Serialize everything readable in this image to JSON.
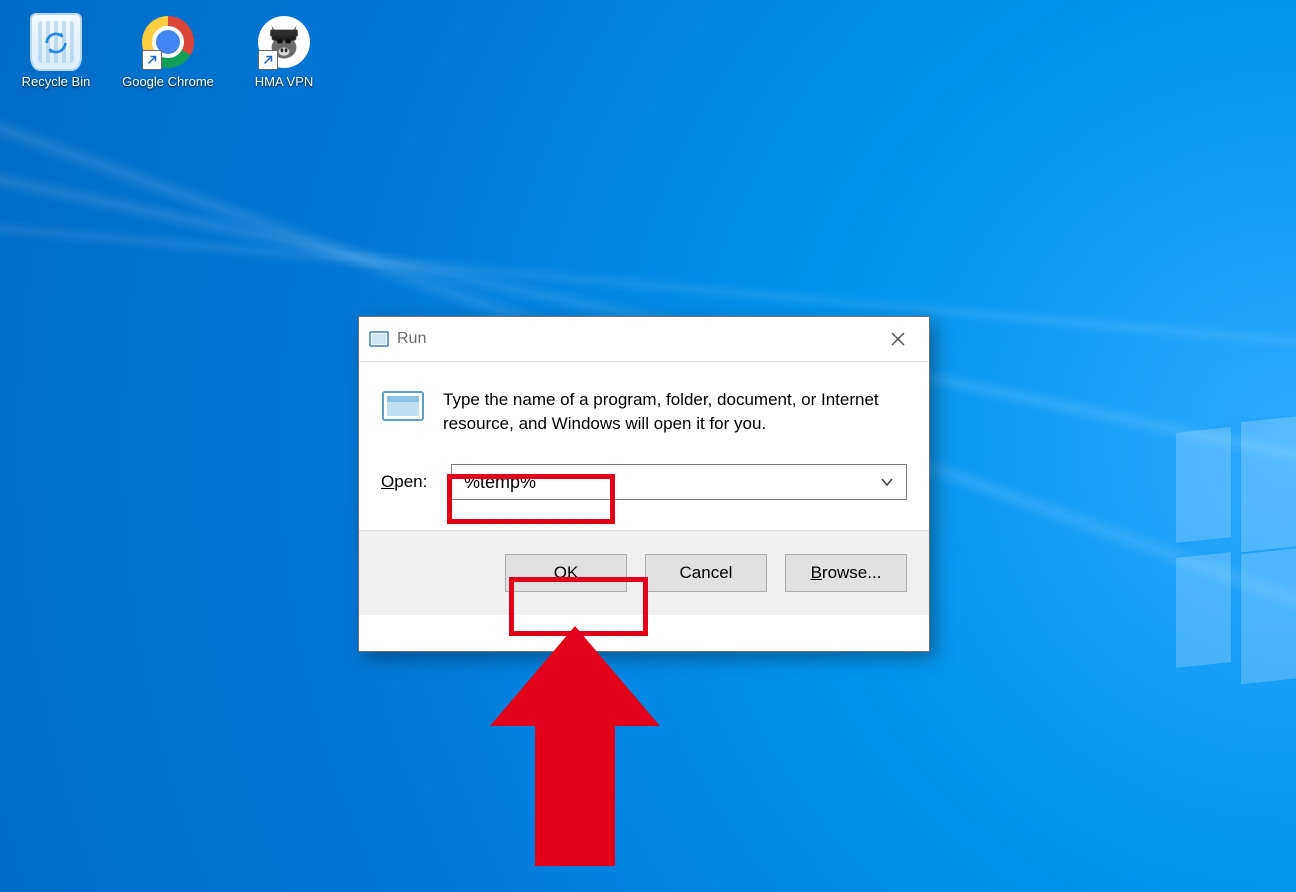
{
  "desktop": {
    "icons": {
      "recycle_bin": {
        "label": "Recycle Bin"
      },
      "chrome": {
        "label": "Google Chrome"
      },
      "hma": {
        "label": "HMA VPN"
      }
    }
  },
  "run_dialog": {
    "title": "Run",
    "description": "Type the name of a program, folder, document, or Internet resource, and Windows will open it for you.",
    "open_label_pre": "O",
    "open_label_post": "pen:",
    "input_value": "%temp%",
    "buttons": {
      "ok": "OK",
      "cancel": "Cancel",
      "browse_pre": "B",
      "browse_post": "rowse..."
    }
  },
  "annotation": {
    "highlight_input": true,
    "highlight_ok": true,
    "arrow_points_to": "ok"
  }
}
